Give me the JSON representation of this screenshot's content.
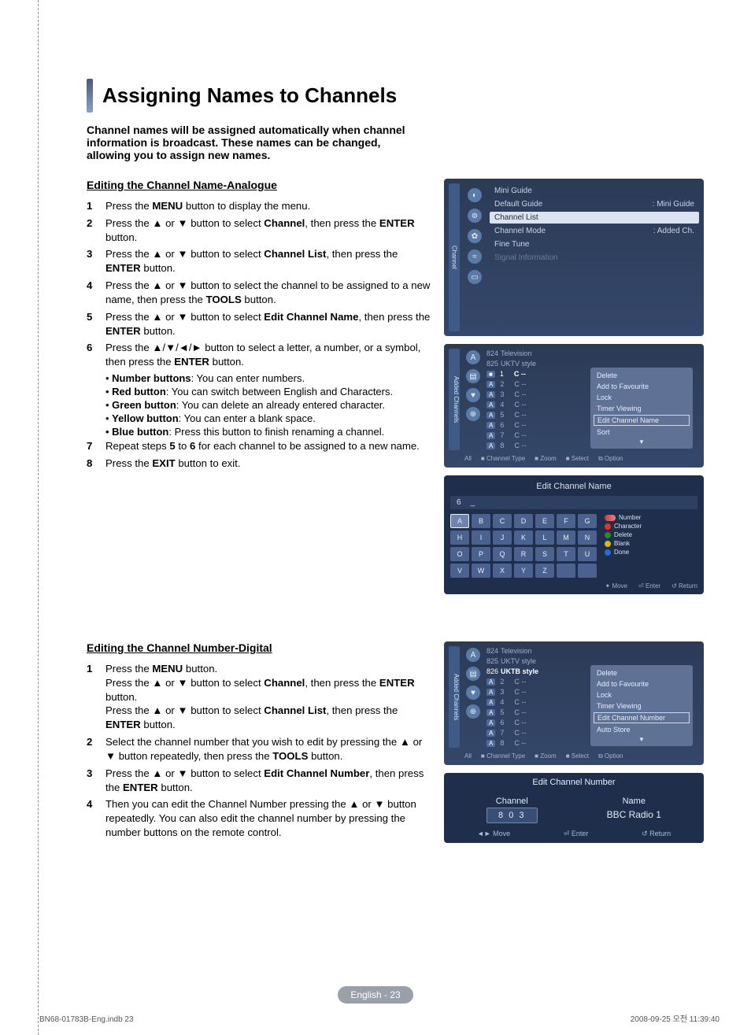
{
  "title": "Assigning Names to Channels",
  "intro": "Channel names will be assigned automatically when channel information is broadcast. These names can be changed, allowing you to assign new names.",
  "section1": {
    "heading": "Editing the Channel Name-Analogue",
    "steps": [
      {
        "n": "1",
        "html": "Press the <b>MENU</b> button to display the menu."
      },
      {
        "n": "2",
        "html": "Press the ▲ or ▼ button to select <b>Channel</b>, then press the <b>ENTER</b> button."
      },
      {
        "n": "3",
        "html": "Press the ▲ or ▼ button to select <b>Channel List</b>, then press the <b>ENTER</b> button."
      },
      {
        "n": "4",
        "html": "Press the ▲ or ▼ button to select the channel to be assigned to a new name, then press the <b>TOOLS</b> button."
      },
      {
        "n": "5",
        "html": "Press the ▲ or ▼ button to select <b>Edit Channel Name</b>, then press the <b>ENTER</b> button."
      },
      {
        "n": "6",
        "html": "Press the ▲/▼/◄/► button to select a letter, a number, or a symbol, then press the <b>ENTER</b> button."
      }
    ],
    "bullets": [
      {
        "label": "Number buttons",
        "text": ": You can enter numbers."
      },
      {
        "label": "Red button",
        "text": ": You can switch between English and Characters."
      },
      {
        "label": "Green button",
        "text": ": You can delete an already entered character."
      },
      {
        "label": "Yellow button",
        "text": ": You can enter a blank space."
      },
      {
        "label": "Blue button",
        "text": ": Press this button to finish renaming a channel."
      }
    ],
    "step7": {
      "n": "7",
      "html": "Repeat steps <b>5</b> to <b>6</b> for each channel to be assigned to a new name."
    },
    "step8": {
      "n": "8",
      "html": "Press the <b>EXIT</b> button to exit."
    }
  },
  "menu1": {
    "sidetab": "Channel",
    "items": [
      {
        "l": "Mini Guide",
        "r": ""
      },
      {
        "l": "Default Guide",
        "r": ": Mini Guide"
      },
      {
        "l": "Channel List",
        "r": "",
        "hl": true
      },
      {
        "l": "Channel Mode",
        "r": ": Added Ch."
      },
      {
        "l": "Fine Tune",
        "r": ""
      },
      {
        "l": "Signal Information",
        "r": "",
        "dim": true
      }
    ]
  },
  "chlist1": {
    "sidetab": "Added Channels",
    "top": [
      {
        "n": "824",
        "txt": "Television"
      },
      {
        "n": "825",
        "txt": "UKTV style"
      }
    ],
    "hl": {
      "tag": "■",
      "n": "1",
      "txt": "C --"
    },
    "rows": [
      {
        "tag": "A",
        "n": "2",
        "txt": "C --"
      },
      {
        "tag": "A",
        "n": "3",
        "txt": "C --"
      },
      {
        "tag": "A",
        "n": "4",
        "txt": "C --"
      },
      {
        "tag": "A",
        "n": "5",
        "txt": "C --"
      },
      {
        "tag": "A",
        "n": "6",
        "txt": "C --"
      },
      {
        "tag": "A",
        "n": "7",
        "txt": "C --"
      },
      {
        "tag": "A",
        "n": "8",
        "txt": "C --"
      }
    ],
    "popup": [
      "Delete",
      "Add to Favourite",
      "Lock",
      "Timer Viewing",
      "Edit Channel Name",
      "Sort"
    ],
    "popup_hl_index": 4,
    "foot": [
      "All",
      "■ Channel Type",
      "■ Zoom",
      "■ Select",
      "⧉ Option"
    ]
  },
  "keyboard": {
    "title": "Edit Channel Name",
    "entry_left": "6",
    "entry_right": "_",
    "keys": [
      "A",
      "B",
      "C",
      "D",
      "E",
      "F",
      "G",
      "H",
      "I",
      "J",
      "K",
      "L",
      "M",
      "N",
      "O",
      "P",
      "Q",
      "R",
      "S",
      "T",
      "U",
      "V",
      "W",
      "X",
      "Y",
      "Z",
      "",
      ""
    ],
    "legend": [
      {
        "cls": "smr",
        "txt": "Number"
      },
      {
        "cls": "red",
        "txt": "Character"
      },
      {
        "cls": "grn",
        "txt": "Delete"
      },
      {
        "cls": "yel",
        "txt": "Blank"
      },
      {
        "cls": "blu",
        "txt": "Done"
      }
    ],
    "foot": [
      "✦ Move",
      "⏎ Enter",
      "↺ Return"
    ]
  },
  "section2": {
    "heading": "Editing the Channel Number-Digital",
    "steps": [
      {
        "n": "1",
        "html": "Press the <b>MENU</b> button.<br>Press the ▲ or ▼ button to select <b>Channel</b>, then press the <b>ENTER</b> button.<br>Press the ▲ or ▼ button to select <b>Channel List</b>, then press the <b>ENTER</b> button."
      },
      {
        "n": "2",
        "html": "Select the channel number that you wish to edit by pressing the ▲ or ▼ button repeatedly, then press the <b>TOOLS</b> button."
      },
      {
        "n": "3",
        "html": "Press the ▲ or ▼ button to select <b>Edit Channel Number</b>, then press the <b>ENTER</b> button."
      },
      {
        "n": "4",
        "html": "Then you can edit the Channel Number pressing the ▲ or ▼ button repeatedly. You can also edit the channel number by pressing the number buttons on the remote control."
      }
    ]
  },
  "chlist2": {
    "sidetab": "Added Channels",
    "top": [
      {
        "n": "824",
        "txt": "Television"
      },
      {
        "n": "825",
        "txt": "UKTV style"
      }
    ],
    "hl": {
      "n": "826",
      "txt": "UKTB style"
    },
    "rows": [
      {
        "tag": "A",
        "n": "2",
        "txt": "C --"
      },
      {
        "tag": "A",
        "n": "3",
        "txt": "C --"
      },
      {
        "tag": "A",
        "n": "4",
        "txt": "C --"
      },
      {
        "tag": "A",
        "n": "5",
        "txt": "C --"
      },
      {
        "tag": "A",
        "n": "6",
        "txt": "C --"
      },
      {
        "tag": "A",
        "n": "7",
        "txt": "C --"
      },
      {
        "tag": "A",
        "n": "8",
        "txt": "C --"
      }
    ],
    "popup": [
      "Delete",
      "Add to Favourite",
      "Lock",
      "Timer Viewing",
      "Edit Channel Number",
      "Auto Store"
    ],
    "popup_hl_index": 4,
    "foot": [
      "All",
      "■ Channel Type",
      "■ Zoom",
      "■ Select",
      "⧉ Option"
    ]
  },
  "ecn": {
    "title": "Edit Channel Number",
    "ch_label": "Channel",
    "ch_val": "8 0 3",
    "nm_label": "Name",
    "nm_val": "BBC Radio 1",
    "foot": [
      "◄► Move",
      "⏎ Enter",
      "↺ Return"
    ]
  },
  "pagefoot": "English - 23",
  "indb": "BN68-01783B-Eng.indb   23",
  "indb2": "2008-09-25   오전 11:39:40"
}
